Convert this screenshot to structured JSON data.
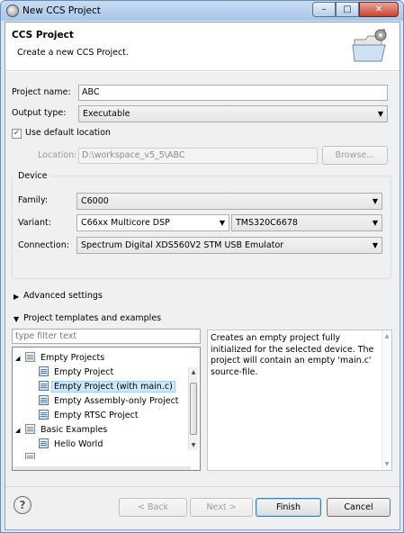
{
  "window": {
    "title": "New CCS Project",
    "min_glyph": "–",
    "max_glyph": "□",
    "close_glyph": "✕"
  },
  "banner": {
    "title": "CCS Project",
    "description": "Create a new CCS Project."
  },
  "form": {
    "project_name_label": "Project name:",
    "project_name_value": "ABC",
    "output_type_label": "Output type:",
    "output_type_value": "Executable",
    "use_default_location_label": "Use default location",
    "use_default_location_checked": true,
    "location_label": "Location:",
    "location_value": "D:\\workspace_v5_5\\ABC",
    "browse_label": "Browse..."
  },
  "device": {
    "group_title": "Device",
    "family_label": "Family:",
    "family_value": "C6000",
    "variant_label": "Variant:",
    "variant_filter_value": "C66xx Multicore DSP",
    "variant_value": "TMS320C6678",
    "connection_label": "Connection:",
    "connection_value": "Spectrum Digital XDS560V2 STM USB Emulator"
  },
  "sections": {
    "advanced_settings": "Advanced settings",
    "project_templates": "Project templates and examples"
  },
  "templates": {
    "filter_placeholder": "type filter text",
    "items": [
      {
        "label": "Empty Projects",
        "kind": "folder",
        "level": 0,
        "expanded": true
      },
      {
        "label": "Empty Project",
        "kind": "project",
        "level": 1
      },
      {
        "label": "Empty Project (with main.c)",
        "kind": "project",
        "level": 1,
        "selected": true
      },
      {
        "label": "Empty Assembly-only Project",
        "kind": "project",
        "level": 1
      },
      {
        "label": "Empty RTSC Project",
        "kind": "project",
        "level": 1
      },
      {
        "label": "Basic Examples",
        "kind": "folder",
        "level": 0,
        "expanded": true
      },
      {
        "label": "Hello World",
        "kind": "project",
        "level": 1
      }
    ],
    "description": "Creates an empty project fully initialized for the selected device. The project will contain an empty 'main.c' source-file."
  },
  "buttons": {
    "help_glyph": "?",
    "back": "< Back",
    "next": "Next >",
    "finish": "Finish",
    "cancel": "Cancel"
  }
}
